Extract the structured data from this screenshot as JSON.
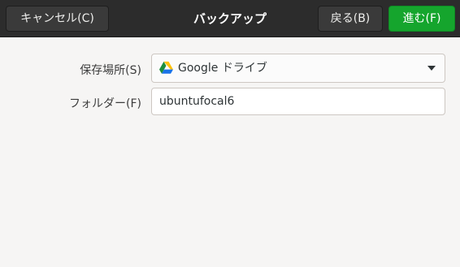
{
  "headerbar": {
    "title": "バックアップ",
    "cancel_label": "キャンセル(C)",
    "back_label": "戻る(B)",
    "forward_label": "進む(F)",
    "forward_color": "#15a52d"
  },
  "form": {
    "location_label": "保存場所(S)",
    "location_value": "Google ドライブ",
    "location_icon": "google-drive-icon",
    "folder_label": "フォルダー(F)",
    "folder_value": "ubuntufocal6"
  }
}
